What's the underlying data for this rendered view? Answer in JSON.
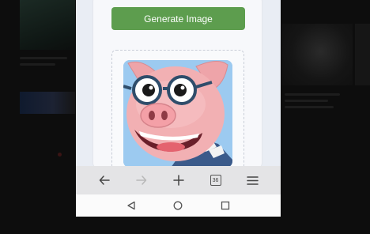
{
  "page": {
    "generate_button_label": "Generate Image",
    "image_subject": "cartoon pig wearing glasses and striped shirt"
  },
  "browser_toolbar": {
    "back_icon": "arrow-left-icon",
    "forward_icon": "arrow-right-icon",
    "new_tab_icon": "plus-icon",
    "tab_count": "36",
    "menu_icon": "hamburger-menu-icon"
  },
  "system_nav": {
    "back_icon": "triangle-back-icon",
    "home_icon": "circle-home-icon",
    "recents_icon": "square-recents-icon"
  },
  "colors": {
    "button_green": "#5d9d4e",
    "image_bg": "#9ccaf0",
    "pig_pink": "#f2b0b3"
  }
}
